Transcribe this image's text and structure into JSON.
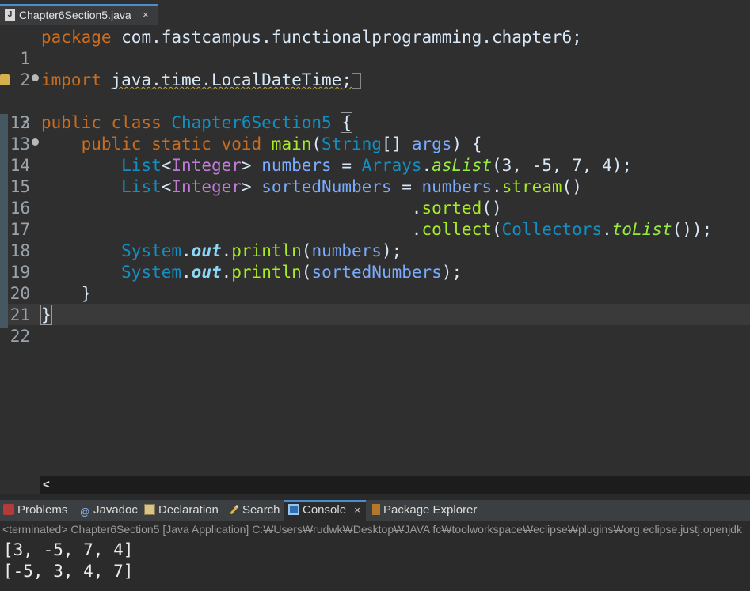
{
  "editor_tab": {
    "title": "Chapter6Section5.java",
    "close": "×",
    "icon": "J"
  },
  "code_lines": [
    {
      "num": "1"
    },
    {
      "num": "2"
    },
    {
      "num": "3"
    },
    {
      "num": "12"
    },
    {
      "num": "13"
    },
    {
      "num": "14"
    },
    {
      "num": "15"
    },
    {
      "num": "16"
    },
    {
      "num": "17"
    },
    {
      "num": "18"
    },
    {
      "num": "19"
    },
    {
      "num": "20"
    },
    {
      "num": "21"
    },
    {
      "num": "22"
    }
  ],
  "code": {
    "l1_kw": "package",
    "l1_rest": " com.fastcampus.functionalprogramming.chapter6;",
    "l3_kw": "import",
    "l3_pkg": "java.time.LocalDateTime",
    "l3_semi": ";",
    "l13_kw": "public class ",
    "l13_cls": "Chapter6Section5",
    "l13_brace": "{",
    "l14_indent": "    ",
    "l14_kw": "public static void ",
    "l14_meth": "main",
    "l14_p1": "(",
    "l14_type": "String",
    "l14_p2": "[] ",
    "l14_arg": "args",
    "l14_p3": ") {",
    "l15_indent": "        ",
    "l15_type": "List",
    "l15_lt": "<",
    "l15_gen": "Integer",
    "l15_gt": "> ",
    "l15_var": "numbers",
    "l15_eq": " = ",
    "l15_cls": "Arrays",
    "l15_dot": ".",
    "l15_meth": "asList",
    "l15_args": "(3, -5, 7, 4);",
    "l16_indent": "        ",
    "l16_type": "List",
    "l16_lt": "<",
    "l16_gen": "Integer",
    "l16_gt": "> ",
    "l16_var": "sortedNumbers",
    "l16_eq": " = ",
    "l16_ref": "numbers",
    "l16_dot": ".",
    "l16_meth": "stream",
    "l16_p": "()",
    "l17_indent": "                                     ",
    "l17_dot": ".",
    "l17_meth": "sorted",
    "l17_p": "()",
    "l18_indent": "                                     ",
    "l18_dot": ".",
    "l18_meth": "collect",
    "l18_p1": "(",
    "l18_cls": "Collectors",
    "l18_dot2": ".",
    "l18_stat": "toList",
    "l18_p2": "());",
    "l19_indent": "        ",
    "l19_cls": "System",
    "l19_dot": ".",
    "l19_fld": "out",
    "l19_dot2": ".",
    "l19_meth": "println",
    "l19_p1": "(",
    "l19_var": "numbers",
    "l19_p2": ");",
    "l20_indent": "        ",
    "l20_cls": "System",
    "l20_dot": ".",
    "l20_fld": "out",
    "l20_dot2": ".",
    "l20_meth": "println",
    "l20_p1": "(",
    "l20_var": "sortedNumbers",
    "l20_p2": ");",
    "l21": "    }",
    "l22": "}"
  },
  "scrollbar": {
    "left_arrow": "<"
  },
  "panel_tabs": [
    {
      "label": "Problems"
    },
    {
      "label": "Javadoc",
      "icon_text": "@"
    },
    {
      "label": "Declaration"
    },
    {
      "label": "Search"
    },
    {
      "label": "Console",
      "close": "×"
    },
    {
      "label": "Package Explorer"
    }
  ],
  "console": {
    "header": "<terminated> Chapter6Section5 [Java Application] C:₩Users₩rudwk₩Desktop₩JAVA fc₩toolworkspace₩eclipse₩plugins₩org.eclipse.justj.openjdk",
    "output": [
      "[3, -5, 7, 4]",
      "[-5, 3, 4, 7]"
    ]
  },
  "colors": {
    "accent": "#4a8ed0",
    "keyword": "#cc6c1d",
    "type": "#1290c3",
    "method": "#a7ec21",
    "variable": "#79abff",
    "generic": "#bf7bd8"
  }
}
